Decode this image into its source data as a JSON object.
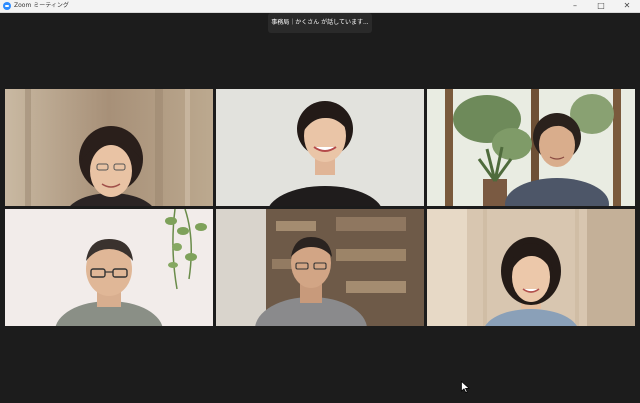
{
  "window": {
    "title": "Zoom ミーティング",
    "controls": {
      "minimize": "–",
      "maximize": "□",
      "close": "✕"
    }
  },
  "speaking_indicator": "事務局｜かくさん が話しています...",
  "colors": {
    "background": "#1c1c1c",
    "titlebar": "#f3f3f3",
    "brand": "#2d8cff",
    "indicator": "#2a2a2a"
  },
  "video_grid": {
    "rows": 2,
    "columns": 3,
    "tiles": [
      {
        "scene": "curtain-background",
        "person": "short-hair-woman-glasses"
      },
      {
        "scene": "white-wall",
        "person": "woman-black-top"
      },
      {
        "scene": "window-plants",
        "person": "short-hair-woman-grey-jacket"
      },
      {
        "scene": "white-wall-ivy",
        "person": "man-glasses"
      },
      {
        "scene": "bookshelf",
        "person": "man-grey-shirt"
      },
      {
        "scene": "curtain-light",
        "person": "woman-striped-shirt"
      }
    ]
  }
}
